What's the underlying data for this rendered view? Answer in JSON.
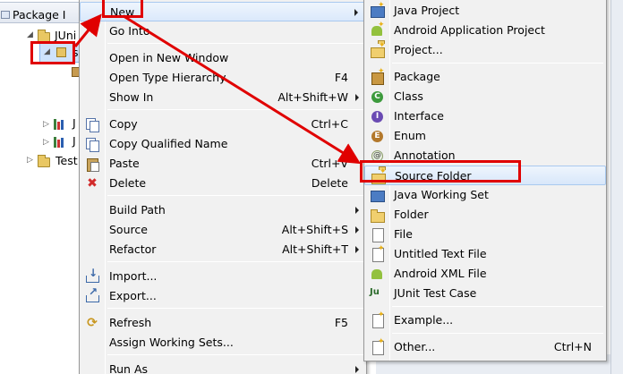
{
  "explorer": {
    "tab_label": "Package I",
    "tree": [
      {
        "label": "JUni",
        "level": 1
      },
      {
        "label": "s",
        "level": 2,
        "selected": true
      },
      {
        "label": "J",
        "level": 2
      },
      {
        "label": "J",
        "level": 2
      },
      {
        "label": "Test",
        "level": 1
      }
    ]
  },
  "menu": {
    "items": [
      {
        "label": "New",
        "shortcut": "",
        "submenu": true,
        "icon": "",
        "hover": true
      },
      {
        "label": "Go Into",
        "shortcut": "",
        "icon": ""
      },
      {
        "label": "Open in New Window",
        "shortcut": "",
        "icon": ""
      },
      {
        "label": "Open Type Hierarchy",
        "shortcut": "F4",
        "icon": ""
      },
      {
        "label": "Show In",
        "shortcut": "Alt+Shift+W",
        "submenu": true,
        "icon": ""
      },
      {
        "label": "Copy",
        "shortcut": "Ctrl+C",
        "icon": "copy-icon"
      },
      {
        "label": "Copy Qualified Name",
        "shortcut": "",
        "icon": "copy-qualified-icon"
      },
      {
        "label": "Paste",
        "shortcut": "Ctrl+V",
        "icon": "paste-icon"
      },
      {
        "label": "Delete",
        "shortcut": "Delete",
        "icon": "delete-icon"
      },
      {
        "label": "Build Path",
        "shortcut": "",
        "submenu": true,
        "icon": ""
      },
      {
        "label": "Source",
        "shortcut": "Alt+Shift+S",
        "submenu": true,
        "icon": ""
      },
      {
        "label": "Refactor",
        "shortcut": "Alt+Shift+T",
        "submenu": true,
        "icon": ""
      },
      {
        "label": "Import...",
        "shortcut": "",
        "icon": "import-icon"
      },
      {
        "label": "Export...",
        "shortcut": "",
        "icon": "export-icon"
      },
      {
        "label": "Refresh",
        "shortcut": "F5",
        "icon": "refresh-icon"
      },
      {
        "label": "Assign Working Sets...",
        "shortcut": "",
        "icon": ""
      },
      {
        "label": "Run As",
        "shortcut": "",
        "submenu": true,
        "icon": ""
      }
    ]
  },
  "submenu": {
    "items": [
      {
        "label": "Java Project",
        "shortcut": "",
        "icon": "java-project-icon"
      },
      {
        "label": "Android Application Project",
        "shortcut": "",
        "icon": "android-project-icon"
      },
      {
        "label": "Project...",
        "shortcut": "",
        "icon": "project-icon"
      },
      {
        "label": "Package",
        "shortcut": "",
        "icon": "package-icon"
      },
      {
        "label": "Class",
        "shortcut": "",
        "icon": "class-icon"
      },
      {
        "label": "Interface",
        "shortcut": "",
        "icon": "interface-icon"
      },
      {
        "label": "Enum",
        "shortcut": "",
        "icon": "enum-icon"
      },
      {
        "label": "Annotation",
        "shortcut": "",
        "icon": "annotation-icon"
      },
      {
        "label": "Source Folder",
        "shortcut": "",
        "icon": "source-folder-icon",
        "hover": true
      },
      {
        "label": "Java Working Set",
        "shortcut": "",
        "icon": "working-set-icon"
      },
      {
        "label": "Folder",
        "shortcut": "",
        "icon": "folder-icon"
      },
      {
        "label": "File",
        "shortcut": "",
        "icon": "file-icon"
      },
      {
        "label": "Untitled Text File",
        "shortcut": "",
        "icon": "text-file-icon"
      },
      {
        "label": "Android XML File",
        "shortcut": "",
        "icon": "android-xml-icon"
      },
      {
        "label": "JUnit Test Case",
        "shortcut": "",
        "icon": "junit-icon"
      },
      {
        "label": "Example...",
        "shortcut": "",
        "icon": "example-icon"
      },
      {
        "label": "Other...",
        "shortcut": "Ctrl+N",
        "icon": "other-icon"
      }
    ]
  },
  "colors": {
    "annotation_red": "#e00000",
    "menu_bg": "#f1f1f1",
    "hover_bg": "#dbe9fb"
  }
}
